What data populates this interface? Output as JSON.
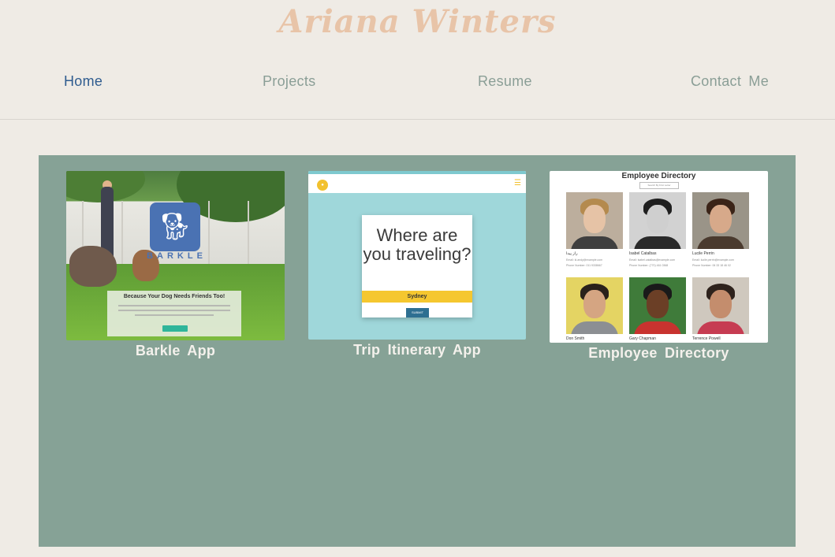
{
  "header": {
    "title": "Ariana Winters"
  },
  "nav": {
    "home": "Home",
    "projects": "Projects",
    "resume": "Resume",
    "contact": "Contact  Me"
  },
  "projects": [
    {
      "label": "Barkle  App",
      "thumbnail": {
        "logo_word": "BARKLE",
        "headline": "Because Your Dog Needs Friends Too!"
      }
    },
    {
      "label": "Trip  Itinerary  App",
      "thumbnail": {
        "question": "Where are you traveling?",
        "input_value": "Sydney",
        "button": "SUBMIT"
      }
    },
    {
      "label": "Employee  Directory",
      "thumbnail": {
        "title": "Employee Directory",
        "search_placeholder": "Search By First Letter",
        "employees": [
          {
            "name": "راز پیدا",
            "email": "Email: ki.andy@example.com",
            "phone": "Phone Number: 011 9338667"
          },
          {
            "name": "Isabel Catalbas",
            "email": "Email: isabel.catalbas@example.com",
            "phone": "Phone Number: (770) 461 0368"
          },
          {
            "name": "Lucile Perrin",
            "email": "Email: lucile.perrin@example.com",
            "phone": "Phone Number: 06 33 18 46 02"
          },
          {
            "name": "Don Smith",
            "email": "",
            "phone": ""
          },
          {
            "name": "Gary Chapman",
            "email": "",
            "phone": ""
          },
          {
            "name": "Terrence Powell",
            "email": "",
            "phone": ""
          }
        ]
      }
    }
  ],
  "colors": {
    "background": "#efebe5",
    "title": "#e8c4a8",
    "nav_active": "#2f5c8f",
    "nav_inactive": "#8a9e96",
    "panel": "#86a296"
  }
}
